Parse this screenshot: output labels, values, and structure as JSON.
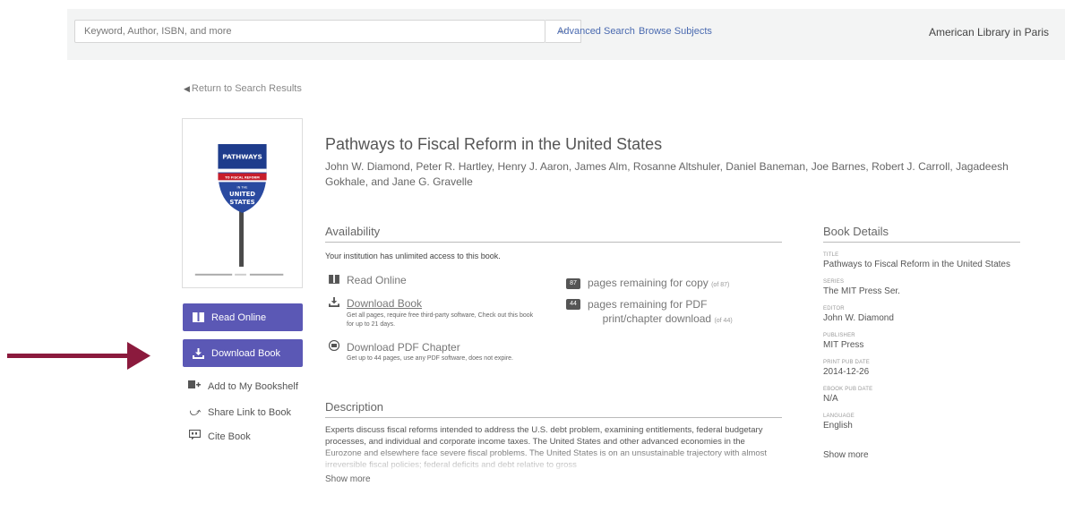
{
  "search": {
    "placeholder": "Keyword, Author, ISBN, and more",
    "submit_icon": "return-enter-icon"
  },
  "top_nav": {
    "advanced_search": "Advanced Search",
    "browse_subjects": "Browse Subjects",
    "library_name": "American Library in Paris"
  },
  "return_link": "Return to Search Results",
  "cover": {
    "line1": "PATHWAYS",
    "line2": "TO FISCAL REFORM",
    "line3": "IN THE",
    "line4": "UNITED",
    "line5": "STATES"
  },
  "side_actions": {
    "read_online": "Read Online",
    "download_book": "Download Book",
    "add_bookshelf": "Add to My Bookshelf",
    "share_link": "Share Link to Book",
    "cite_book": "Cite Book"
  },
  "book": {
    "title": "Pathways to Fiscal Reform in the United States",
    "authors": "John W. Diamond, Peter R. Hartley, Henry J. Aaron, James Alm, Rosanne Altshuler, Daniel Baneman, Joe Barnes, Robert J. Carroll, Jagadeesh Gokhale, and Jane G. Gravelle"
  },
  "availability": {
    "heading": "Availability",
    "note": "Your institution has unlimited access to this book.",
    "read_online": "Read Online",
    "download_book": "Download Book",
    "download_sub": "Get all pages, require free third-party software, Check out this book for up to 21 days.",
    "download_pdf": "Download PDF Chapter",
    "pdf_sub": "Get up to 44 pages, use any PDF software, does not expire.",
    "copy_count": "87",
    "copy_text": "pages remaining for copy",
    "copy_of": "(of 87)",
    "pdf_count": "44",
    "pdf_text_1": "pages remaining for PDF",
    "pdf_text_2": "print/chapter download",
    "pdf_of": "(of 44)"
  },
  "description": {
    "heading": "Description",
    "text": "Experts discuss fiscal reforms intended to address the U.S. debt problem, examining entitlements, federal budgetary processes, and individual and corporate income taxes. The United States and other advanced economies in the Eurozone and elsewhere face severe fiscal problems. The United States is on an unsustainable trajectory with almost irreversible fiscal policies; federal deficits and debt relative to gross",
    "show_more": "Show more"
  },
  "details": {
    "heading": "Book Details",
    "title_label": "Title",
    "title_value": "Pathways to Fiscal Reform in the United States",
    "series_label": "Series",
    "series_value": "The MIT Press Ser.",
    "editor_label": "Editor",
    "editor_value": "John W. Diamond",
    "publisher_label": "Publisher",
    "publisher_value": "MIT Press",
    "print_date_label": "Print Pub Date",
    "print_date_value": "2014-12-26",
    "ebook_date_label": "Ebook Pub Date",
    "ebook_date_value": "N/A",
    "language_label": "Language",
    "language_value": "English",
    "show_more": "Show more"
  },
  "colors": {
    "button_purple": "#5b58b5",
    "arrow_red": "#8b1a3d",
    "link_blue": "#4a6ab0"
  }
}
